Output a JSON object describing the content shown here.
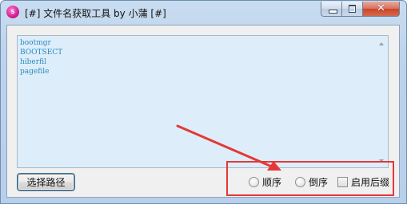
{
  "window": {
    "app_icon_text": "S",
    "title": "[#] 文件名获取工具 by 小蒲 [#]",
    "controls": {
      "minimize": "minimize-icon",
      "maximize": "maximize-icon",
      "close_glyph": "✕"
    }
  },
  "textarea": {
    "lines": [
      "bootmgr",
      "BOOTSECT",
      "hiberfil",
      "pagefile"
    ]
  },
  "buttons": {
    "select_path": "选择路径"
  },
  "options": {
    "ascending": "顺序",
    "descending": "倒序",
    "enable_suffix": "启用后缀"
  },
  "colors": {
    "text_area_bg": "#ddeefa",
    "text_color": "#2a8abf",
    "annotation": "#e53838"
  }
}
